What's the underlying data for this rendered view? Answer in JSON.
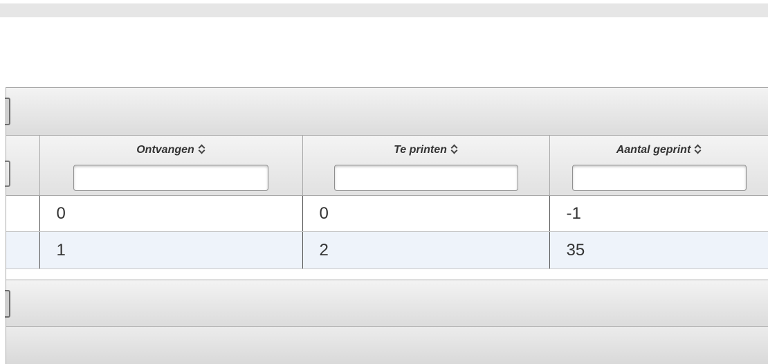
{
  "grid": {
    "columns": [
      {
        "title": "Ontvangen",
        "sort_icon": "sort-updown-icon",
        "filter_value": ""
      },
      {
        "title": "Te printen",
        "sort_icon": "sort-updown-icon",
        "filter_value": ""
      },
      {
        "title": "Aantal geprint",
        "sort_icon": "sort-updown-icon",
        "filter_value": ""
      }
    ],
    "rows": [
      {
        "cells": [
          "0",
          "0",
          "-1"
        ]
      },
      {
        "cells": [
          "1",
          "2",
          "35"
        ]
      }
    ]
  },
  "colors": {
    "header_bg": "#e6e6e6",
    "alt_row_bg": "#eef3fa",
    "text": "#333333"
  }
}
